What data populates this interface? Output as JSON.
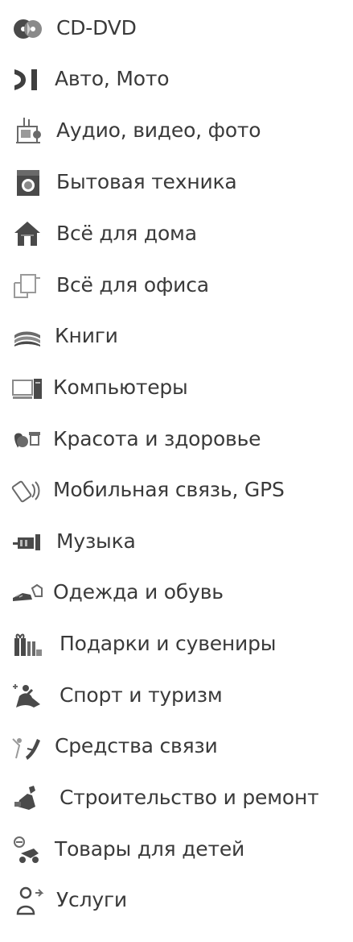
{
  "menu": {
    "items": [
      {
        "label": "CD-DVD",
        "icon": "cd-dvd-icon"
      },
      {
        "label": "Авто, Мото",
        "icon": "car-moto-icon"
      },
      {
        "label": "Аудио, видео, фото",
        "icon": "audio-video-photo-icon"
      },
      {
        "label": "Бытовая техника",
        "icon": "washing-machine-icon"
      },
      {
        "label": "Всё для дома",
        "icon": "house-icon"
      },
      {
        "label": "Всё для офиса",
        "icon": "office-icon"
      },
      {
        "label": "Книги",
        "icon": "books-icon"
      },
      {
        "label": "Компьютеры",
        "icon": "computer-icon"
      },
      {
        "label": "Красота и здоровье",
        "icon": "beauty-health-icon"
      },
      {
        "label": "Мобильная связь, GPS",
        "icon": "mobile-gps-icon"
      },
      {
        "label": "Музыка",
        "icon": "music-icon"
      },
      {
        "label": "Одежда и обувь",
        "icon": "clothes-shoes-icon"
      },
      {
        "label": "Подарки и сувениры",
        "icon": "gifts-icon"
      },
      {
        "label": "Спорт и туризм",
        "icon": "sport-tourism-icon"
      },
      {
        "label": "Средства связи",
        "icon": "communications-icon"
      },
      {
        "label": "Строительство и ремонт",
        "icon": "construction-icon"
      },
      {
        "label": "Товары для детей",
        "icon": "children-goods-icon"
      },
      {
        "label": "Услуги",
        "icon": "services-icon"
      }
    ]
  },
  "colors": {
    "text": "#3a3a3a",
    "icon": "#4a4a4a",
    "icon_light": "#9a9a9a",
    "background": "#ffffff"
  }
}
